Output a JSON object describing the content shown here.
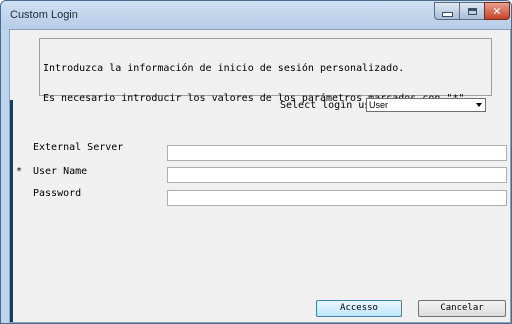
{
  "window": {
    "title": "Custom Login",
    "controls": [
      "minimize",
      "maximize",
      "close"
    ]
  },
  "info": {
    "line1": "Introduzca la información de inicio de sesión personalizado.",
    "line2": "Es necesario introducir los valores de los parámetros marcados con \"*\"."
  },
  "select_login_user": {
    "label": "Select login user",
    "value": "User"
  },
  "fields": {
    "external_server": {
      "label": "External Server",
      "required": false,
      "value": ""
    },
    "user_name": {
      "marker": "*",
      "label": "User Name",
      "required": true,
      "value": ""
    },
    "password": {
      "label": "Password",
      "required": false,
      "value": ""
    }
  },
  "buttons": {
    "accept": "Accesso",
    "cancel": "Cancelar"
  },
  "colors": {
    "title_bar": "#c6dbf1",
    "close_button": "#c4412a",
    "client_bg": "#f0f0f0",
    "primary_button": "#bee6fd"
  }
}
